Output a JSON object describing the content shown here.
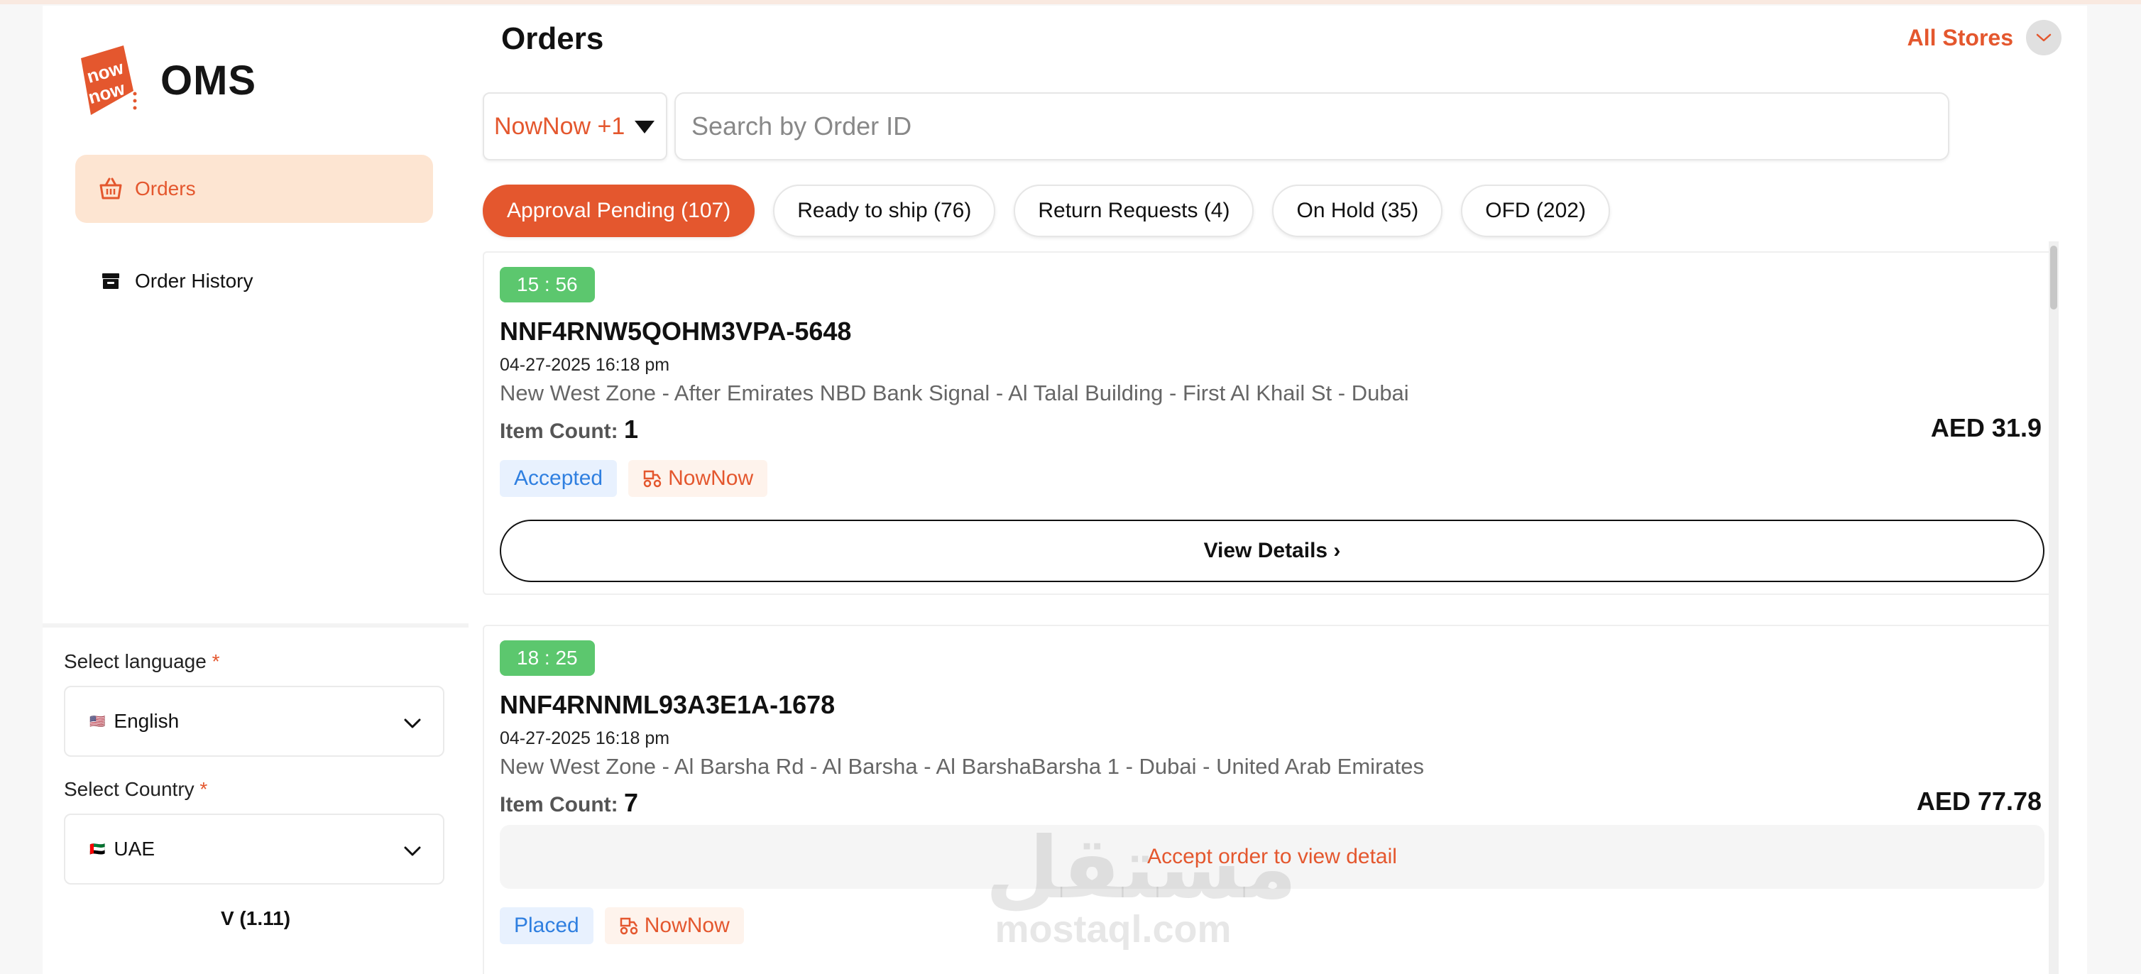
{
  "brand": {
    "logo_text": "OMS",
    "logo_mark": "nowNow",
    "accent": "#e4572e",
    "active_bg": "#fde5d2"
  },
  "sidebar": {
    "items": [
      {
        "label": "Orders",
        "icon": "basket-icon",
        "active": true
      },
      {
        "label": "Order History",
        "icon": "archive-icon",
        "active": false
      }
    ],
    "language": {
      "label": "Select language",
      "required_mark": "*",
      "flag": "🇺🇸",
      "value": "English"
    },
    "country": {
      "label": "Select Country",
      "required_mark": "*",
      "flag": "🇦🇪",
      "value": "UAE"
    },
    "version": "V (1.11)"
  },
  "header": {
    "title": "Orders",
    "store_switch": "All Stores"
  },
  "filters": {
    "platform": "NowNow +1",
    "search_placeholder": "Search by Order ID"
  },
  "tabs": [
    {
      "label": "Approval Pending (107)",
      "active": true
    },
    {
      "label": "Ready to ship (76)",
      "active": false
    },
    {
      "label": "Return Requests (4)",
      "active": false
    },
    {
      "label": "On Hold (35)",
      "active": false
    },
    {
      "label": "OFD (202)",
      "active": false
    }
  ],
  "orders": [
    {
      "timer": "15 : 56",
      "id": "NNF4RNW5QOHM3VPA-5648",
      "date": "04-27-2025 16:18 pm",
      "address": "New West Zone - After Emirates NBD Bank Signal - Al Talal Building - First Al Khail St - Dubai",
      "item_count_label": "Item Count:",
      "item_count": "1",
      "amount": "AED 31.9",
      "status": "Accepted",
      "channel": "NowNow",
      "action": "View Details ›"
    },
    {
      "timer": "18 : 25",
      "id": "NNF4RNNML93A3E1A-1678",
      "date": "04-27-2025 16:18 pm",
      "address": "New West Zone - Al Barsha Rd - Al Barsha - Al BarshaBarsha 1 - Dubai - United Arab Emirates",
      "item_count_label": "Item Count:",
      "item_count": "7",
      "amount": "AED 77.78",
      "notice": "Accept order to view detail",
      "status": "Placed",
      "channel": "NowNow"
    }
  ],
  "watermark": {
    "arabic": "مستقل",
    "latin": "mostaql.com"
  }
}
